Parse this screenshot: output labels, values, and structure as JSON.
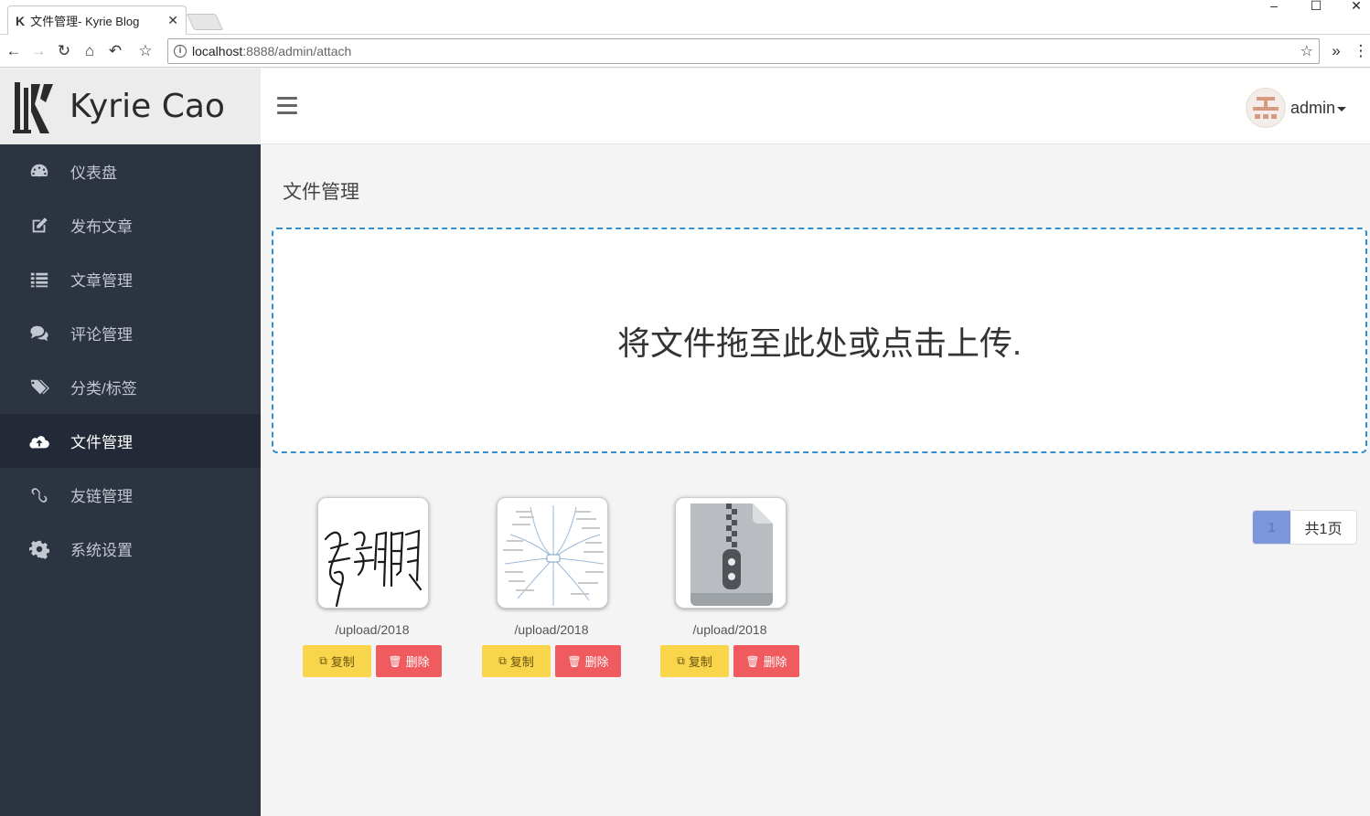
{
  "browser": {
    "tab_title": "文件管理- Kyrie Blog",
    "url_host": "localhost",
    "url_rest": ":8888/admin/attach"
  },
  "brand": {
    "name": "Kyrie Cao"
  },
  "sidebar": {
    "items": [
      {
        "label": "仪表盘",
        "icon": "dashboard-icon"
      },
      {
        "label": "发布文章",
        "icon": "edit-icon"
      },
      {
        "label": "文章管理",
        "icon": "list-icon"
      },
      {
        "label": "评论管理",
        "icon": "comments-icon"
      },
      {
        "label": "分类/标签",
        "icon": "tags-icon"
      },
      {
        "label": "文件管理",
        "icon": "cloud-upload-icon",
        "active": true
      },
      {
        "label": "友链管理",
        "icon": "link-icon"
      },
      {
        "label": "系统设置",
        "icon": "gear-icon"
      }
    ]
  },
  "header": {
    "user_name": "admin"
  },
  "main": {
    "page_title": "文件管理",
    "dropzone_text": "将文件拖至此处或点击上传.",
    "files": [
      {
        "path": "/upload/2018",
        "thumb": "signature-image",
        "copy_label": "复制",
        "delete_label": "删除"
      },
      {
        "path": "/upload/2018",
        "thumb": "mindmap-image",
        "copy_label": "复制",
        "delete_label": "删除"
      },
      {
        "path": "/upload/2018",
        "thumb": "zip-file-icon",
        "copy_label": "复制",
        "delete_label": "删除"
      }
    ],
    "pagination": {
      "current_page": "1",
      "total_label": "共1页"
    }
  },
  "colors": {
    "sidebar_bg": "#2c3341",
    "sidebar_active_bg": "#232937",
    "dropzone_border": "#2f8fcf",
    "copy_button": "#f8d54a",
    "delete_button": "#ef5b5e",
    "pager_active": "#7b96da"
  }
}
